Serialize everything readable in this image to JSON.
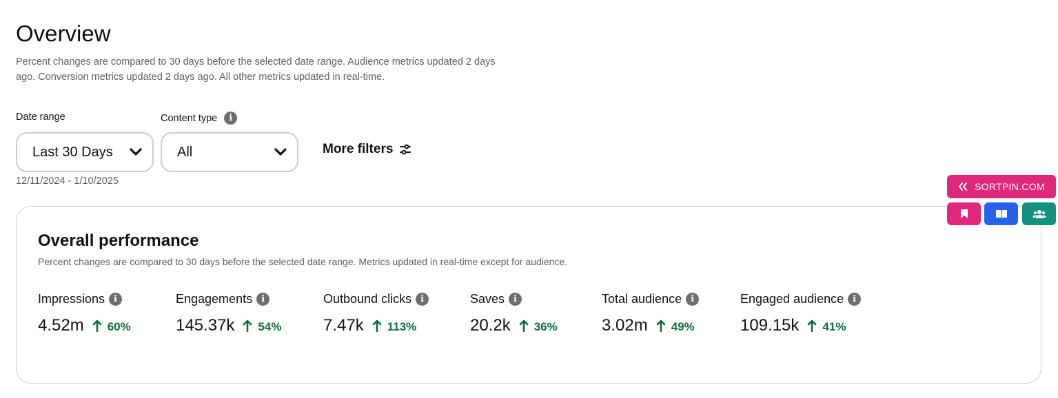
{
  "header": {
    "title": "Overview",
    "subtitle": "Percent changes are compared to 30 days before the selected date range. Audience metrics updated 2 days ago. Conversion metrics updated 2 days ago. All other metrics updated in real-time."
  },
  "filters": {
    "date_range": {
      "label": "Date range",
      "value": "Last 30 Days",
      "range_text": "12/11/2024 - 1/10/2025"
    },
    "content_type": {
      "label": "Content type",
      "value": "All"
    },
    "more_filters_label": "More filters"
  },
  "performance": {
    "title": "Overall performance",
    "subtitle": "Percent changes are compared to 30 days before the selected date range. Metrics updated in real-time except for audience.",
    "metrics": [
      {
        "label": "Impressions",
        "value": "4.52m",
        "change": "60%"
      },
      {
        "label": "Engagements",
        "value": "145.37k",
        "change": "54%"
      },
      {
        "label": "Outbound clicks",
        "value": "7.47k",
        "change": "113%"
      },
      {
        "label": "Saves",
        "value": "20.2k",
        "change": "36%"
      },
      {
        "label": "Total audience",
        "value": "3.02m",
        "change": "49%"
      },
      {
        "label": "Engaged audience",
        "value": "109.15k",
        "change": "41%"
      }
    ]
  },
  "sortpin": {
    "label": "SORTPIN.COM",
    "buttons": [
      "bookmark-icon",
      "book-icon",
      "users-icon"
    ],
    "colors": {
      "pink": "#e0287a",
      "blue": "#2563eb",
      "teal": "#14917e"
    }
  },
  "colors": {
    "positive_change": "#0b6b3a",
    "muted_text": "#5f5f5f"
  }
}
